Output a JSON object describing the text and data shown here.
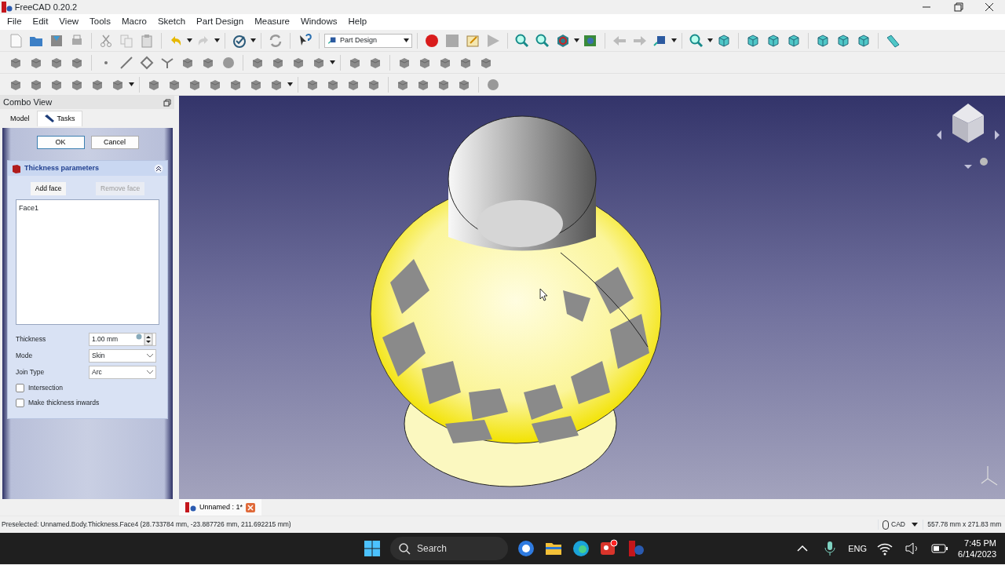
{
  "window": {
    "title": "FreeCAD 0.20.2"
  },
  "menu": [
    "File",
    "Edit",
    "View",
    "Tools",
    "Macro",
    "Sketch",
    "Part Design",
    "Measure",
    "Windows",
    "Help"
  ],
  "workbench": {
    "value": "Part Design"
  },
  "combo_view": {
    "title": "Combo View",
    "tabs": [
      {
        "label": "Model",
        "selected": false
      },
      {
        "label": "Tasks",
        "selected": true
      }
    ],
    "buttons": [
      "OK",
      "Cancel"
    ],
    "panel": {
      "title": "Thickness parameters",
      "expanded": true,
      "face_buttons": [
        {
          "label": "Add face",
          "disabled": false
        },
        {
          "label": "Remove face",
          "disabled": true
        }
      ],
      "faces": [
        "Face1"
      ],
      "fields": [
        {
          "kind": "spin",
          "label": "Thickness",
          "value": "1.00 mm"
        },
        {
          "kind": "select",
          "label": "Mode",
          "value": "Skin"
        },
        {
          "kind": "select",
          "label": "Join Type",
          "value": "Arc"
        }
      ],
      "options": [
        {
          "label": "Intersection",
          "checked": false
        },
        {
          "label": "Make thickness inwards",
          "checked": false
        }
      ]
    }
  },
  "document_tabs": [
    {
      "label": "Unnamed : 1*",
      "selected": true
    }
  ],
  "status_bar": {
    "message": "Preselected: Unnamed.Body.Thickness.Face4 (28.733784 mm, -23.887726 mm, 211.692215 mm)",
    "nav_style": "CAD",
    "dimensions": "557.78 mm x 271.83 mm"
  },
  "taskbar": {
    "search": {
      "placeholder": "Search"
    },
    "language": "ENG",
    "time": "7:45 PM",
    "date": "6/14/2023"
  }
}
